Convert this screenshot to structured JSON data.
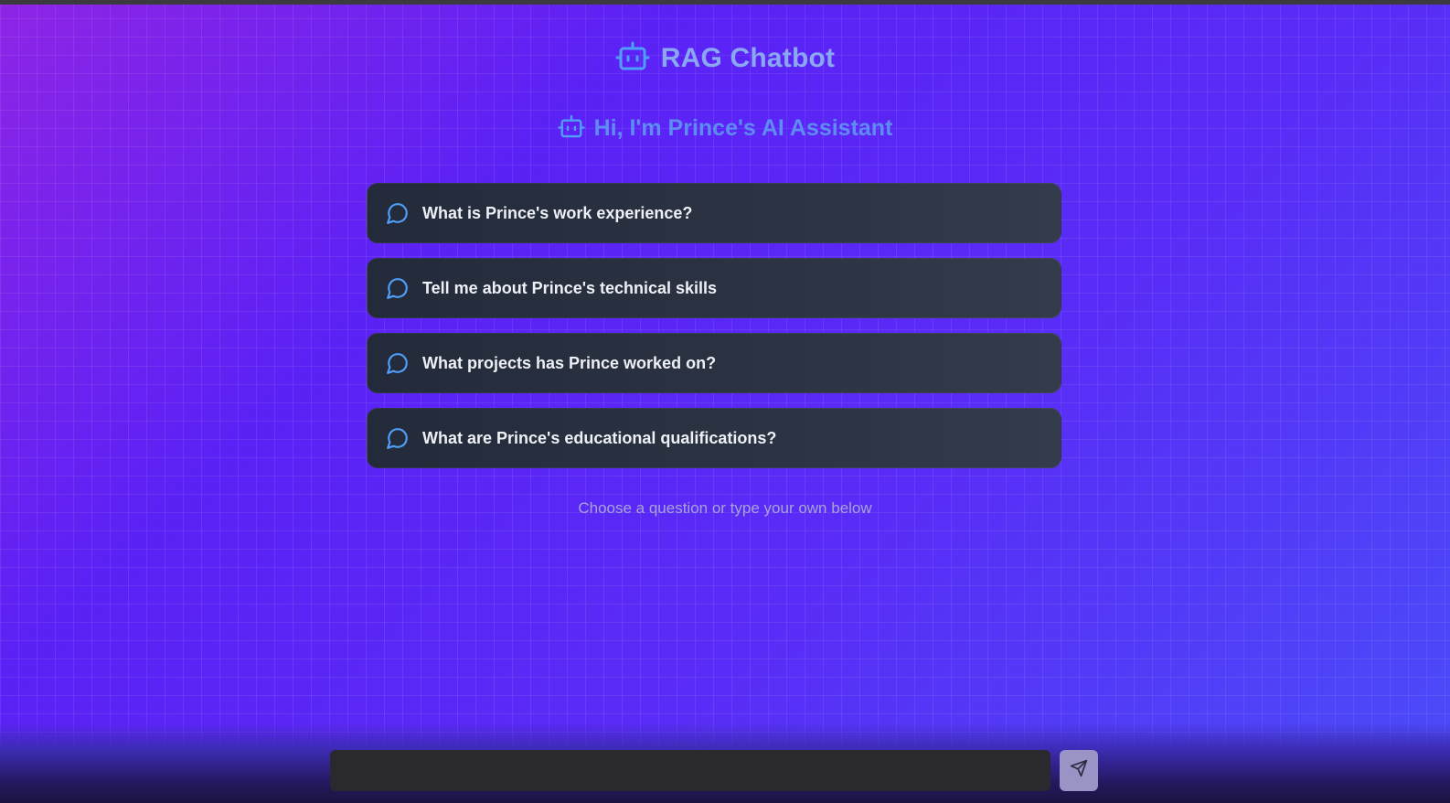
{
  "app": {
    "title": "RAG Chatbot"
  },
  "greeting": {
    "text": "Hi, I'm Prince's AI Assistant"
  },
  "suggested_questions": [
    {
      "label": "What is Prince's work experience?",
      "icon": "chat-bubble-icon"
    },
    {
      "label": "Tell me about Prince's technical skills",
      "icon": "chat-bubble-icon"
    },
    {
      "label": "What projects has Prince worked on?",
      "icon": "chat-bubble-icon"
    },
    {
      "label": "What are Prince's educational qualifications?",
      "icon": "chat-bubble-icon"
    }
  ],
  "hint": "Choose a question or type your own below",
  "composer": {
    "value": "",
    "placeholder": "",
    "send_icon": "send-icon"
  },
  "colors": {
    "title": "#8aa7f2",
    "greeting": "#5e8cf3",
    "icon_accent": "#4f9ef8",
    "card_bg": "#2c3444",
    "input_bg": "#2a2a2e",
    "send_bg": "#9a94c6"
  }
}
